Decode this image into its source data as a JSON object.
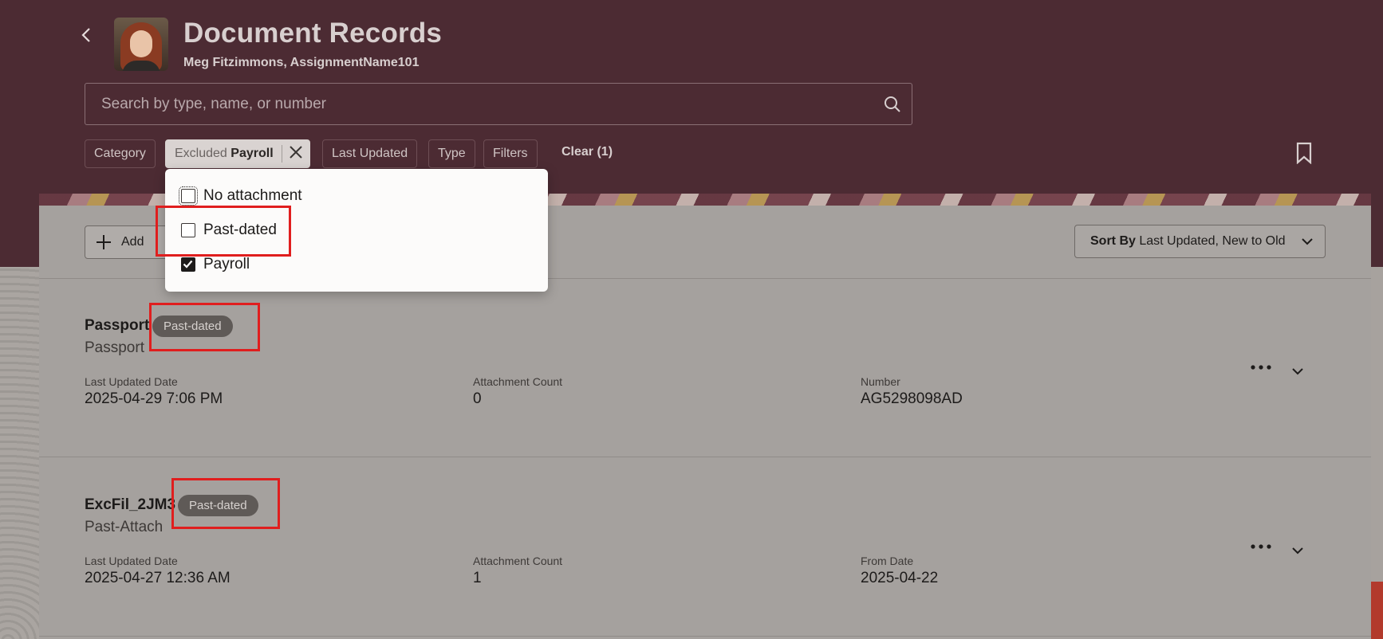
{
  "header": {
    "title": "Document Records",
    "subtitle": "Meg Fitzimmons, AssignmentName101",
    "search_placeholder": "Search by type, name, or number"
  },
  "filters": {
    "category": "Category",
    "active_chip": {
      "prefix": "Excluded",
      "value": "Payroll"
    },
    "last_updated": "Last Updated",
    "type": "Type",
    "filters": "Filters",
    "clear": "Clear (1)"
  },
  "dropdown": {
    "options": [
      {
        "label": "No attachment",
        "checked": false
      },
      {
        "label": "Past-dated",
        "checked": false
      },
      {
        "label": "Payroll",
        "checked": true
      }
    ]
  },
  "toolbar": {
    "add_label": "Add",
    "sort_prefix": "Sort By",
    "sort_value": "Last Updated, New to Old"
  },
  "records": [
    {
      "title": "Passport",
      "badge": "Past-dated",
      "subtitle": "Passport",
      "fields": [
        {
          "label": "Last Updated Date",
          "value": "2025-04-29 7:06 PM"
        },
        {
          "label": "Attachment Count",
          "value": "0"
        },
        {
          "label": "Number",
          "value": "AG5298098AD"
        }
      ]
    },
    {
      "title": "ExcFil_2JM3",
      "badge": "Past-dated",
      "subtitle": "Past-Attach",
      "fields": [
        {
          "label": "Last Updated Date",
          "value": "2025-04-27 12:36 AM"
        },
        {
          "label": "Attachment Count",
          "value": "1"
        },
        {
          "label": "From Date",
          "value": "2025-04-22"
        }
      ]
    }
  ],
  "colors": {
    "header_bg": "#4c2b33",
    "highlight": "#e01e1e",
    "badge_bg": "#5f5a57"
  }
}
